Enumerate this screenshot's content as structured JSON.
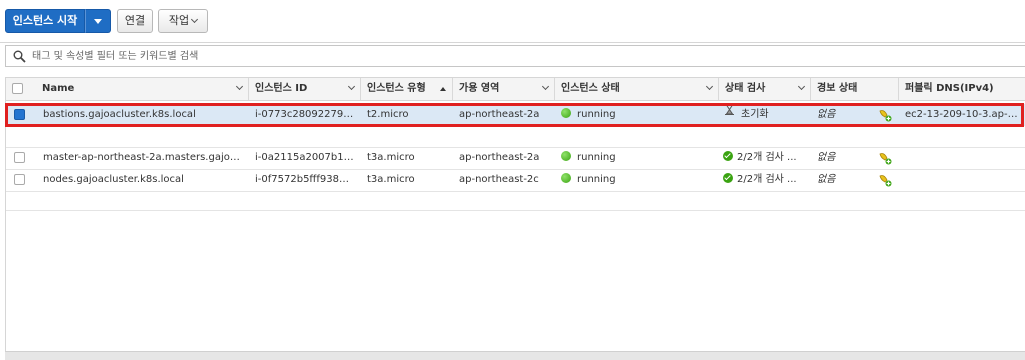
{
  "toolbar": {
    "launch_label": "인스턴스 시작",
    "connect_label": "연결",
    "actions_label": "작업"
  },
  "search": {
    "placeholder": "태그 및 속성별 필터 또는 키워드별 검색",
    "value": ""
  },
  "table": {
    "columns": {
      "name": "Name",
      "instance_id": "인스턴스 ID",
      "instance_type": "인스턴스 유형",
      "az": "가용 영역",
      "state": "인스턴스 상태",
      "status_check": "상태 검사",
      "alarm": "경보 상태",
      "public_dns": "퍼블릭 DNS(IPv4)"
    },
    "rows": [
      {
        "name": "bastions.gajoacluster.k8s.local",
        "instance_id": "i-0773c28092279aaf9",
        "instance_type": "t2.micro",
        "az": "ap-northeast-2a",
        "state": "running",
        "status_check": "초기화",
        "alarm": "없음",
        "public_dns": "ec2-13-209-10-3.ap-n...",
        "selected": true
      },
      {
        "name": "master-ap-northeast-2a.masters.gajoaclu...",
        "instance_id": "i-0a2115a2007b14...",
        "instance_type": "t3a.micro",
        "az": "ap-northeast-2a",
        "state": "running",
        "status_check": "2/2개 검사 ...",
        "alarm": "없음",
        "public_dns": "",
        "selected": false
      },
      {
        "name": "nodes.gajoacluster.k8s.local",
        "instance_id": "i-0f7572b5fff938597",
        "instance_type": "t3a.micro",
        "az": "ap-northeast-2c",
        "state": "running",
        "status_check": "2/2개 검사 ...",
        "alarm": "없음",
        "public_dns": "",
        "selected": false
      }
    ]
  },
  "icons": {
    "search": "search-icon",
    "hourglass": "hourglass-icon",
    "check": "check-circle-icon",
    "running": "running-dot-icon",
    "alarm": "alarm-add-icon"
  },
  "colors": {
    "primary": "#1f6dc4",
    "running": "#3aa311",
    "selection_outline": "#e02020",
    "selected_row": "#dbe8f5"
  }
}
